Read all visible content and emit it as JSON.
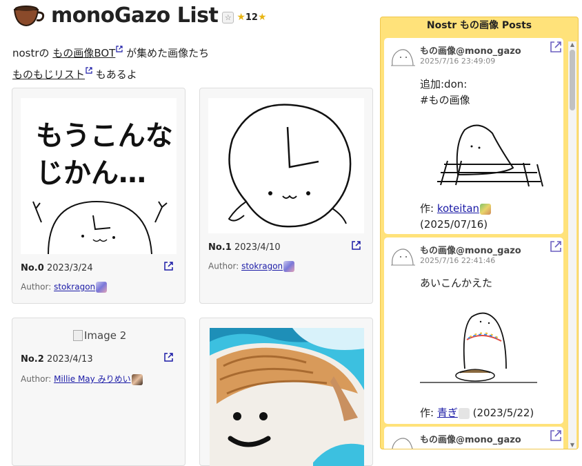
{
  "header": {
    "title": "monoGazo List",
    "star_count": "12"
  },
  "intro": {
    "line1_prefix": "nostrの",
    "bot_link": "もの画像BOT",
    "line1_suffix": "が集めた画像たち",
    "list_link": "ものもじリスト",
    "line2_suffix": "もあるよ"
  },
  "cards": [
    {
      "no": "No.0",
      "date": "2023/3/24",
      "author_label": "Author:",
      "author": "stokragon",
      "image_text": [
        "もうこんな",
        "じかん…"
      ]
    },
    {
      "no": "No.1",
      "date": "2023/4/10",
      "author_label": "Author:",
      "author": "stokragon"
    },
    {
      "no": "No.2",
      "date": "2023/4/13",
      "author_label": "Author:",
      "author": "Millie May みりめい",
      "broken_alt": "Image 2"
    },
    {
      "no": "",
      "date": "",
      "author_label": "",
      "author": ""
    }
  ],
  "sidebar": {
    "title": "Nostr もの画像 Posts",
    "posts": [
      {
        "name": "もの画像@mono_gazo",
        "date": "2025/7/16 23:49:09",
        "lines": [
          "追加:don:",
          "#もの画像"
        ],
        "credit_label": "作:",
        "credit_name": "koteitan",
        "credit_date": "(2025/07/16)"
      },
      {
        "name": "もの画像@mono_gazo",
        "date": "2025/7/16 22:41:46",
        "lines": [
          "あいこんかえた"
        ],
        "credit_label": "作:",
        "credit_name": "青ぎ",
        "credit_date": "(2023/5/22)"
      },
      {
        "name": "もの画像@mono_gazo",
        "date": ""
      }
    ]
  },
  "colors": {
    "sidebar_bg": "#ffe27a",
    "link": "#1a1aa6",
    "accent_star": "#e8b514"
  }
}
